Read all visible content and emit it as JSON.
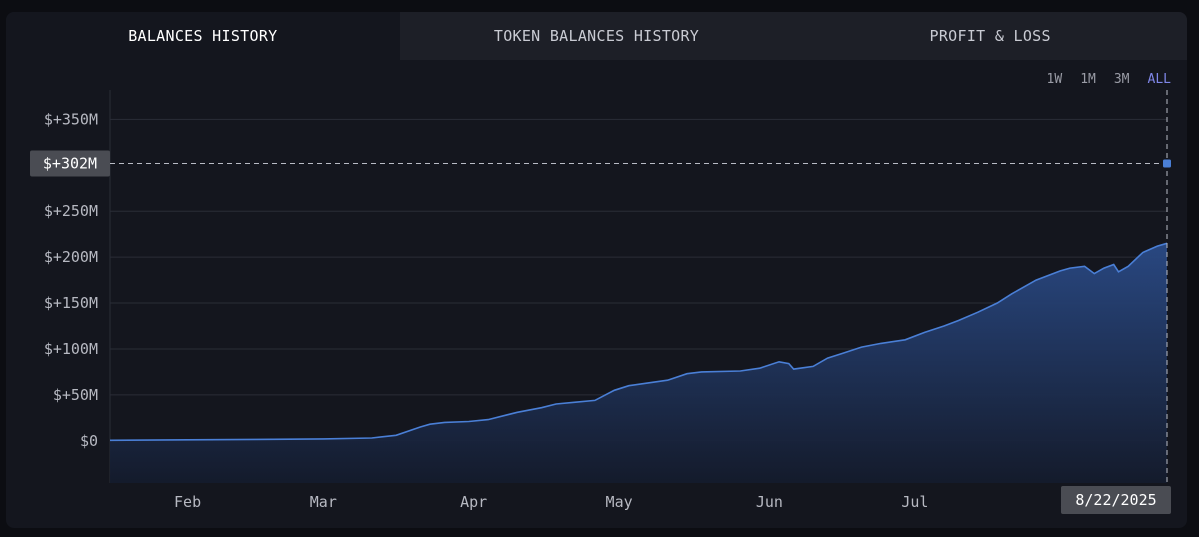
{
  "tabs": [
    {
      "label": "BALANCES HISTORY",
      "active": true
    },
    {
      "label": "TOKEN BALANCES HISTORY",
      "active": false
    },
    {
      "label": "PROFIT & LOSS",
      "active": false
    }
  ],
  "ranges": [
    {
      "label": "1W",
      "active": false
    },
    {
      "label": "1M",
      "active": false
    },
    {
      "label": "3M",
      "active": false
    },
    {
      "label": "ALL",
      "active": true
    }
  ],
  "colors": {
    "accent": "#7f86e8",
    "series_line": "#4a7fd6",
    "area_top": "#2a4a86",
    "area_bottom": "#141b2c",
    "grid": "#2a2d37",
    "crosshair": "#b9bcc6",
    "badge_bg": "#4a4c53"
  },
  "chart_data": {
    "type": "area",
    "title": "",
    "xlabel": "",
    "ylabel": "",
    "y_tick_values": [
      0,
      50,
      100,
      150,
      200,
      250,
      350
    ],
    "y_tick_labels": [
      "$0",
      "$+50M",
      "$+100M",
      "$+150M",
      "$+200M",
      "$+250M",
      "$+350M"
    ],
    "ylim": [
      -46,
      382
    ],
    "x_tick_labels": [
      {
        "label": "Feb",
        "date": "2025-02-01"
      },
      {
        "label": "Mar",
        "date": "2025-03-01"
      },
      {
        "label": "Apr",
        "date": "2025-04-01"
      },
      {
        "label": "May",
        "date": "2025-05-01"
      },
      {
        "label": "Jun",
        "date": "2025-06-01"
      },
      {
        "label": "Jul",
        "date": "2025-07-01"
      },
      {
        "label": "A",
        "date": "2025-08-01"
      }
    ],
    "xlim": [
      "2025-01-16",
      "2025-08-22"
    ],
    "grid": true,
    "crosshair": {
      "date": "2025-08-22",
      "date_label": "8/22/2025",
      "value": 302,
      "value_label": "$+302M"
    },
    "series": [
      {
        "points": [
          [
            "2025-01-16",
            0.5
          ],
          [
            "2025-02-01",
            1
          ],
          [
            "2025-02-15",
            1.5
          ],
          [
            "2025-03-01",
            2
          ],
          [
            "2025-03-11",
            3
          ],
          [
            "2025-03-16",
            6
          ],
          [
            "2025-03-21",
            15
          ],
          [
            "2025-03-23",
            18
          ],
          [
            "2025-03-26",
            20
          ],
          [
            "2025-03-31",
            21
          ],
          [
            "2025-04-04",
            23
          ],
          [
            "2025-04-10",
            31
          ],
          [
            "2025-04-15",
            36
          ],
          [
            "2025-04-18",
            40
          ],
          [
            "2025-04-22",
            42
          ],
          [
            "2025-04-26",
            44
          ],
          [
            "2025-04-30",
            55
          ],
          [
            "2025-05-03",
            60
          ],
          [
            "2025-05-07",
            63
          ],
          [
            "2025-05-11",
            66
          ],
          [
            "2025-05-15",
            73
          ],
          [
            "2025-05-18",
            75
          ],
          [
            "2025-05-26",
            76
          ],
          [
            "2025-05-30",
            79
          ],
          [
            "2025-06-03",
            86
          ],
          [
            "2025-06-05",
            84
          ],
          [
            "2025-06-06",
            78
          ],
          [
            "2025-06-10",
            81
          ],
          [
            "2025-06-13",
            90
          ],
          [
            "2025-06-16",
            95
          ],
          [
            "2025-06-20",
            102
          ],
          [
            "2025-06-24",
            106
          ],
          [
            "2025-06-29",
            110
          ],
          [
            "2025-07-03",
            118
          ],
          [
            "2025-07-07",
            125
          ],
          [
            "2025-07-10",
            131
          ],
          [
            "2025-07-14",
            140
          ],
          [
            "2025-07-18",
            150
          ],
          [
            "2025-07-21",
            160
          ],
          [
            "2025-07-26",
            175
          ],
          [
            "2025-07-31",
            185
          ],
          [
            "2025-08-02",
            188
          ],
          [
            "2025-08-05",
            190
          ],
          [
            "2025-08-07",
            182
          ],
          [
            "2025-08-09",
            188
          ],
          [
            "2025-08-11",
            192
          ],
          [
            "2025-08-12",
            184
          ],
          [
            "2025-08-14",
            190
          ],
          [
            "2025-08-17",
            205
          ],
          [
            "2025-08-20",
            212
          ],
          [
            "2025-08-22",
            215
          ]
        ]
      }
    ]
  }
}
